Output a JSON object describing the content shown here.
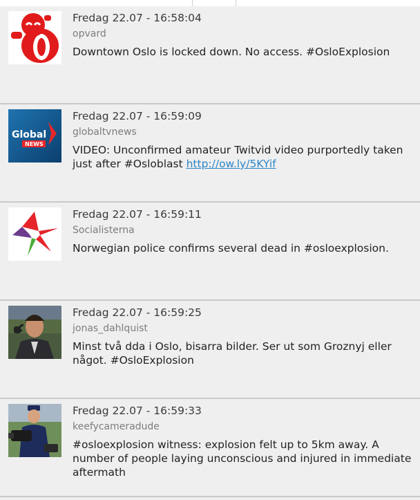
{
  "tweets": [
    {
      "time": "Fredag 22.07 - 16:58:04",
      "user": "opvard",
      "text": "Downtown Oslo is locked down. No access. #OsloExplosion",
      "link": "",
      "avatar_icon": "red-mascot-avatar-icon"
    },
    {
      "time": "Fredag 22.07 - 16:59:09",
      "user": "globaltvnews",
      "text": "VIDEO: Unconfirmed amateur Twitvid video purportedly taken just after #Osloblast ",
      "link": "http://ow.ly/5KYif",
      "avatar_icon": "global-news-logo-icon"
    },
    {
      "time": "Fredag 22.07 - 16:59:11",
      "user": "Socialisterna",
      "text": "Norwegian police confirms several dead in #osloexplosion.",
      "link": "",
      "avatar_icon": "star-logo-icon"
    },
    {
      "time": "Fredag 22.07 - 16:59:25",
      "user": "jonas_dahlquist",
      "text": "Minst två dda i Oslo, bisarra bilder. Ser ut som Groznyj eller något. #OsloExplosion",
      "link": "",
      "avatar_icon": "commentator-photo-avatar"
    },
    {
      "time": "Fredag 22.07 - 16:59:33",
      "user": "keefycameradude",
      "text": "#osloexplosion witness: explosion felt up to 5km away. A number of people laying unconscious and injured in immediate aftermath",
      "link": "",
      "avatar_icon": "cameraman-photo-avatar"
    }
  ],
  "colors": {
    "link": "#2a86c8",
    "background": "#efefef",
    "separator": "#c9c9c9"
  }
}
